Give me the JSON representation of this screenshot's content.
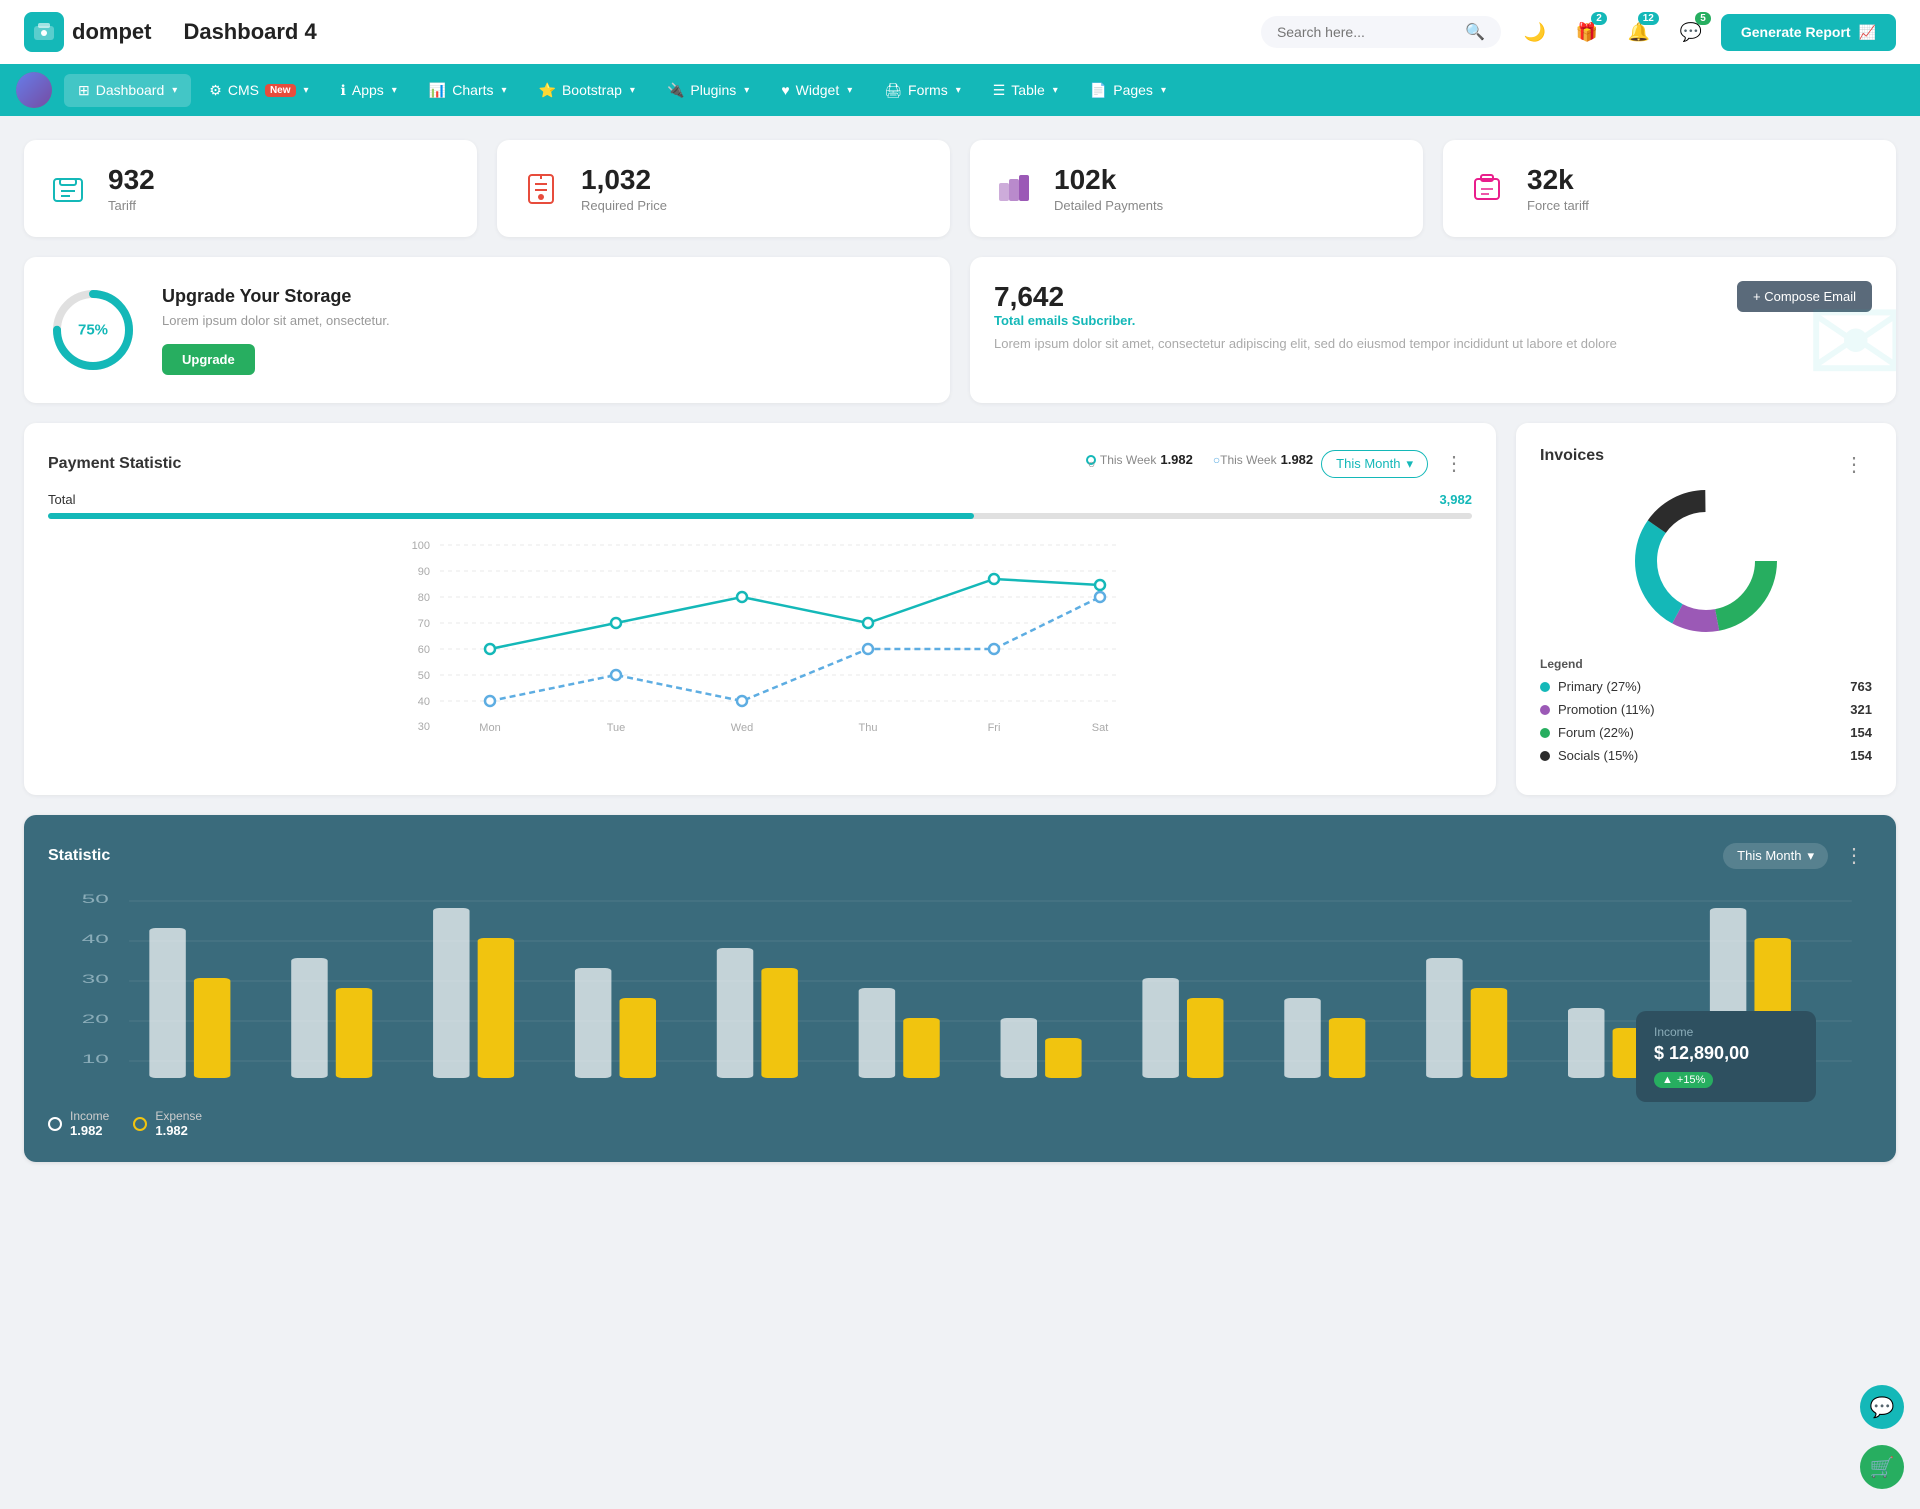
{
  "app": {
    "logo_icon": "💼",
    "logo_text": "dompet",
    "page_title": "Dashboard 4",
    "search_placeholder": "Search here...",
    "generate_btn": "Generate Report"
  },
  "top_icons": [
    {
      "name": "moon-icon",
      "symbol": "🌙",
      "badge": null
    },
    {
      "name": "gift-icon",
      "symbol": "🎁",
      "badge": "2",
      "badge_type": "teal"
    },
    {
      "name": "bell-icon",
      "symbol": "🔔",
      "badge": "12",
      "badge_type": "teal"
    },
    {
      "name": "chat-icon",
      "symbol": "💬",
      "badge": "5",
      "badge_type": "green"
    }
  ],
  "nav": {
    "items": [
      {
        "label": "Dashboard",
        "has_arrow": true,
        "active": true
      },
      {
        "label": "CMS",
        "has_arrow": true,
        "is_new": true
      },
      {
        "label": "Apps",
        "has_arrow": true
      },
      {
        "label": "Charts",
        "has_arrow": true
      },
      {
        "label": "Bootstrap",
        "has_arrow": true
      },
      {
        "label": "Plugins",
        "has_arrow": true
      },
      {
        "label": "Widget",
        "has_arrow": true
      },
      {
        "label": "Forms",
        "has_arrow": true
      },
      {
        "label": "Table",
        "has_arrow": true
      },
      {
        "label": "Pages",
        "has_arrow": true
      }
    ]
  },
  "stat_cards": [
    {
      "num": "932",
      "label": "Tariff",
      "icon": "🏢",
      "color": "#14b8b8"
    },
    {
      "num": "1,032",
      "label": "Required Price",
      "icon": "📄",
      "color": "#e74c3c"
    },
    {
      "num": "102k",
      "label": "Detailed Payments",
      "icon": "📊",
      "color": "#9b59b6"
    },
    {
      "num": "32k",
      "label": "Force tariff",
      "icon": "📦",
      "color": "#e91e8c"
    }
  ],
  "storage": {
    "pct": "75%",
    "title": "Upgrade Your Storage",
    "desc": "Lorem ipsum dolor sit amet, onsectetur.",
    "btn": "Upgrade"
  },
  "email": {
    "num": "7,642",
    "sub": "Total emails Subcriber.",
    "desc": "Lorem ipsum dolor sit amet, consectetur adipiscing elit, sed do eiusmod tempor incididunt ut labore et dolore",
    "compose_btn": "+ Compose Email"
  },
  "payment": {
    "title": "Payment Statistic",
    "filter_btn": "This Month",
    "legend1_label": "This Week",
    "legend1_val": "1.982",
    "legend2_label": "This Week",
    "legend2_val": "1.982",
    "total_label": "Total",
    "total_val": "3,982",
    "x_labels": [
      "Mon",
      "Tue",
      "Wed",
      "Thu",
      "Fri",
      "Sat"
    ],
    "y_labels": [
      "100",
      "90",
      "80",
      "70",
      "60",
      "50",
      "40",
      "30"
    ]
  },
  "invoices": {
    "title": "Invoices",
    "legend_title": "Legend",
    "items": [
      {
        "label": "Primary (27%)",
        "color": "#14b8b8",
        "count": "763"
      },
      {
        "label": "Promotion (11%)",
        "color": "#9b59b6",
        "count": "321"
      },
      {
        "label": "Forum (22%)",
        "color": "#27ae60",
        "count": "154"
      },
      {
        "label": "Socials (15%)",
        "color": "#2c2c2c",
        "count": "154"
      }
    ]
  },
  "statistic": {
    "title": "Statistic",
    "filter_btn": "This Month",
    "income_label": "Income",
    "income_val": "1.982",
    "expense_label": "Expense",
    "expense_val": "1.982",
    "y_labels": [
      "50",
      "40",
      "30",
      "20",
      "10"
    ],
    "income_panel": {
      "label": "Income",
      "amount": "$ 12,890,00",
      "change": "+15%"
    }
  }
}
